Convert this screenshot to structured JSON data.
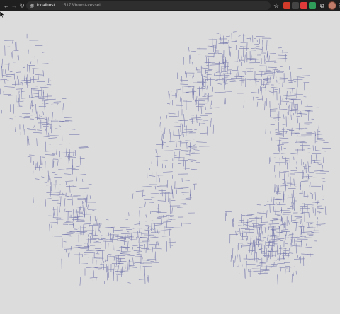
{
  "browser": {
    "url_host": "localhost",
    "url_path": ":5173/boost-vessel",
    "nav_icons": [
      "back-arrow-icon",
      "forward-arrow-icon",
      "reload-icon"
    ],
    "info_icon": "site-info-icon",
    "bookmark_icon": "star-icon",
    "extension_colors": [
      "#d23a2a",
      "#444444",
      "#e03a3a",
      "#2f9c5a"
    ],
    "menu_icon": "more-vertical-icon"
  },
  "canvas": {
    "background": "#dcdcdc",
    "stroke_color": "#7d7fb0",
    "description_icon": "mouse-cursor-icon"
  }
}
